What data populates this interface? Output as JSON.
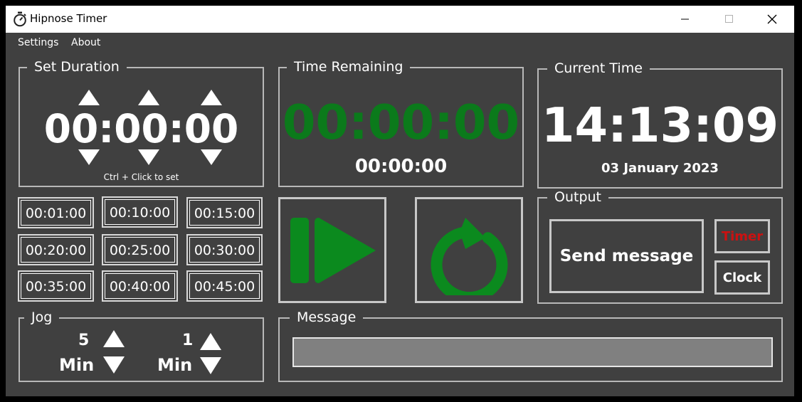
{
  "window": {
    "title": "Hipnose Timer"
  },
  "menu": {
    "settings": "Settings",
    "about": "About"
  },
  "set_duration": {
    "label": "Set Duration",
    "value": "00:00:00",
    "hint": "Ctrl + Click to set"
  },
  "time_remaining": {
    "label": "Time Remaining",
    "big": "00:00:00",
    "small": "00:00:00",
    "big_color": "#0b7a1b"
  },
  "current_time": {
    "label": "Current Time",
    "time": "14:13:09",
    "date": "03 January 2023"
  },
  "presets": [
    "00:01:00",
    "00:10:00",
    "00:15:00",
    "00:20:00",
    "00:25:00",
    "00:30:00",
    "00:35:00",
    "00:40:00",
    "00:45:00"
  ],
  "controls": {
    "play_icon": "play-icon",
    "reset_icon": "reset-icon",
    "accent": "#0b8a1e"
  },
  "output": {
    "label": "Output",
    "send": "Send message",
    "timer": "Timer",
    "clock": "Clock",
    "timer_color": "#cc1111"
  },
  "jog": {
    "label": "Jog",
    "a_value": "5",
    "a_unit": "Min",
    "b_value": "1",
    "b_unit": "Min"
  },
  "message": {
    "label": "Message",
    "value": ""
  }
}
